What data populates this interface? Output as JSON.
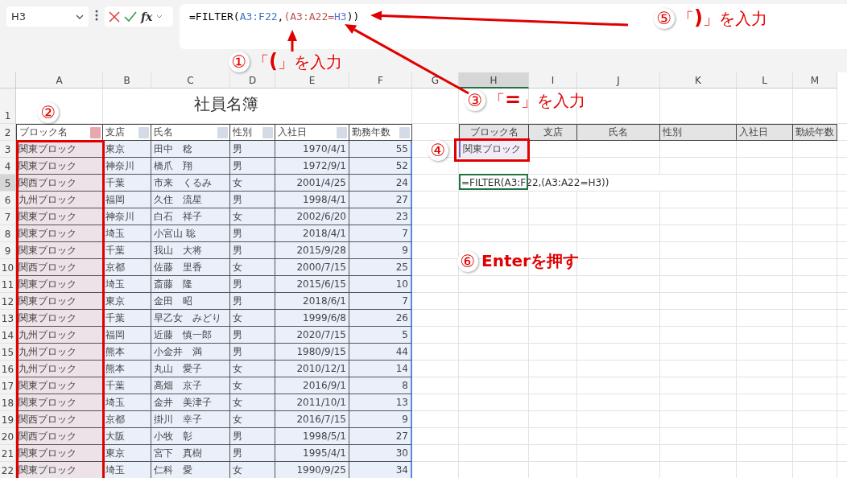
{
  "formula_bar": {
    "name_box": "H3",
    "fx": "fx",
    "formula": [
      {
        "text": "=FILTER("
      },
      {
        "text": "A3:F22",
        "color": "#3f72c4"
      },
      {
        "text": ","
      },
      {
        "text": "(A3:A22=",
        "color": "#c0504d"
      },
      {
        "text": "H3",
        "color": "#5a6fd8"
      },
      {
        "text": "))"
      }
    ]
  },
  "sheet": {
    "column_headers": [
      {
        "label": "A",
        "selected": false
      },
      {
        "label": "B",
        "selected": false
      },
      {
        "label": "C",
        "selected": false
      },
      {
        "label": "D",
        "selected": false
      },
      {
        "label": "E",
        "selected": false
      },
      {
        "label": "F",
        "selected": false
      },
      {
        "label": "G",
        "selected": false
      },
      {
        "label": "H",
        "selected": true
      },
      {
        "label": "I",
        "selected": false
      },
      {
        "label": "J",
        "selected": false
      },
      {
        "label": "K",
        "selected": false
      },
      {
        "label": "L",
        "selected": false
      },
      {
        "label": "M",
        "selected": false
      }
    ],
    "row_headers": [
      {
        "label": "1",
        "selected": false
      },
      {
        "label": "2",
        "selected": false
      },
      {
        "label": "3",
        "selected": false
      },
      {
        "label": "4",
        "selected": false
      },
      {
        "label": "5",
        "selected": true
      },
      {
        "label": "6",
        "selected": false
      },
      {
        "label": "7",
        "selected": false
      },
      {
        "label": "8",
        "selected": false
      },
      {
        "label": "9",
        "selected": false
      },
      {
        "label": "10",
        "selected": false
      },
      {
        "label": "11",
        "selected": false
      },
      {
        "label": "12",
        "selected": false
      },
      {
        "label": "13",
        "selected": false
      },
      {
        "label": "14",
        "selected": false
      },
      {
        "label": "15",
        "selected": false
      },
      {
        "label": "16",
        "selected": false
      },
      {
        "label": "17",
        "selected": false
      },
      {
        "label": "18",
        "selected": false
      },
      {
        "label": "19",
        "selected": false
      },
      {
        "label": "20",
        "selected": false
      },
      {
        "label": "21",
        "selected": false
      },
      {
        "label": "22",
        "selected": false
      }
    ],
    "title": "社員名簿",
    "table": {
      "columns": [
        {
          "label": "ブロック名"
        },
        {
          "label": "支店"
        },
        {
          "label": "氏名"
        },
        {
          "label": "性別"
        },
        {
          "label": "入社日"
        },
        {
          "label": "勤務年数"
        }
      ],
      "rows": [
        [
          "関東ブロック",
          "東京",
          "田中　稔",
          "男",
          "1970/4/1",
          "55"
        ],
        [
          "関東ブロック",
          "神奈川",
          "橋爪　翔",
          "男",
          "1972/9/1",
          "52"
        ],
        [
          "関西ブロック",
          "千葉",
          "市来　くるみ",
          "女",
          "2001/4/25",
          "24"
        ],
        [
          "九州ブロック",
          "福岡",
          "久住　流星",
          "男",
          "1998/4/1",
          "27"
        ],
        [
          "関東ブロック",
          "神奈川",
          "白石　祥子",
          "女",
          "2002/6/20",
          "23"
        ],
        [
          "関東ブロック",
          "埼玉",
          "小宮山 聡",
          "男",
          "2018/4/1",
          "7"
        ],
        [
          "関東ブロック",
          "千葉",
          "我山　大将",
          "男",
          "2015/9/28",
          "9"
        ],
        [
          "関西ブロック",
          "京都",
          "佐藤　里香",
          "女",
          "2000/7/15",
          "25"
        ],
        [
          "関東ブロック",
          "埼玉",
          "斎藤　隆",
          "男",
          "2015/6/15",
          "10"
        ],
        [
          "関東ブロック",
          "東京",
          "金田　昭",
          "男",
          "2018/6/1",
          "7"
        ],
        [
          "関東ブロック",
          "千葉",
          "早乙女　みどり",
          "女",
          "1999/6/8",
          "26"
        ],
        [
          "九州ブロック",
          "福岡",
          "近藤　慎一郎",
          "男",
          "2020/7/15",
          "5"
        ],
        [
          "九州ブロック",
          "熊本",
          "小金井　満",
          "男",
          "1980/9/15",
          "44"
        ],
        [
          "九州ブロック",
          "熊本",
          "丸山　愛子",
          "女",
          "2010/12/1",
          "14"
        ],
        [
          "関東ブロック",
          "千葉",
          "高畑　京子",
          "女",
          "2016/9/1",
          "8"
        ],
        [
          "関東ブロック",
          "埼玉",
          "金井　美津子",
          "女",
          "2011/10/1",
          "13"
        ],
        [
          "関西ブロック",
          "京都",
          "掛川　幸子",
          "女",
          "2016/7/15",
          "9"
        ],
        [
          "関西ブロック",
          "大阪",
          "小牧　彰",
          "男",
          "1998/5/1",
          "27"
        ],
        [
          "関東ブロック",
          "東京",
          "宮下　真樹",
          "男",
          "1995/4/1",
          "30"
        ],
        [
          "関東ブロック",
          "埼玉",
          "仁科　愛",
          "女",
          "1990/9/25",
          "34"
        ]
      ]
    },
    "result_table": {
      "columns": [
        {
          "label": "ブロック名"
        },
        {
          "label": "支店"
        },
        {
          "label": "氏名"
        },
        {
          "label": "性別"
        },
        {
          "label": "入社日"
        },
        {
          "label": "勤続年数"
        }
      ],
      "criteria": "関東ブロック",
      "formula": "=FILTER(A3:F22,(A3:A22=H3))"
    }
  },
  "annotations": [
    {
      "marker": "①",
      "text": "「**(**」を入力"
    },
    {
      "marker": "②"
    },
    {
      "marker": "③",
      "text": "「**=**」を入力"
    },
    {
      "marker": "④"
    },
    {
      "marker": "⑤",
      "text": "「**)**」を入力"
    },
    {
      "marker": "⑥",
      "text": "Enterを押す"
    }
  ]
}
